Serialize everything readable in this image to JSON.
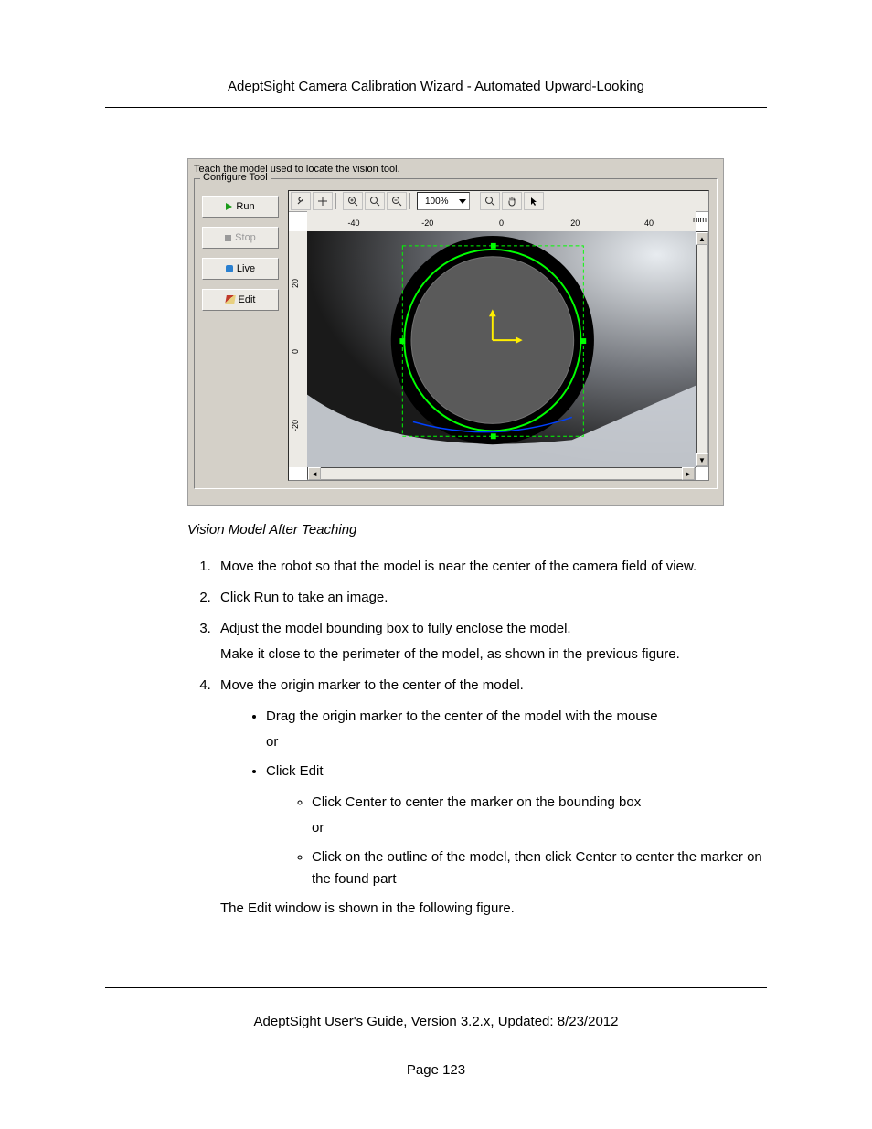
{
  "header": {
    "title": "AdeptSight Camera Calibration Wizard - Automated Upward-Looking"
  },
  "app": {
    "teach_text": "Teach the model used to locate the vision tool.",
    "group_label": "Configure Tool",
    "buttons": {
      "run": "Run",
      "stop": "Stop",
      "live": "Live",
      "edit": "Edit"
    },
    "zoom_value": "100%",
    "ruler_ticks": [
      "-40",
      "-20",
      "0",
      "20",
      "40"
    ],
    "unit": "mm",
    "vruler_ticks": [
      "20",
      "0",
      "-20"
    ]
  },
  "caption": "Vision Model After Teaching",
  "steps": {
    "s1": "Move the robot so that the model is near the center of the camera field of view.",
    "s2": "Click Run to take an image.",
    "s3a": "Adjust the model bounding box to fully enclose the model.",
    "s3b": "Make it close to the perimeter of the model, as shown in the previous figure.",
    "s4": "Move the origin marker to the center of the model.",
    "s4_b1": "Drag the origin marker to the center of the model with the mouse",
    "or1": "or",
    "s4_b2": "Click Edit",
    "s4_b2_s1": "Click Center to center the marker on the bounding box",
    "or2": "or",
    "s4_b2_s2": "Click on the outline of the model, then click Center to center the marker on the found part",
    "s4_tail": "The Edit window is shown in the following figure."
  },
  "footer": {
    "text": "AdeptSight User's Guide,  Version 3.2.x, Updated: 8/23/2012",
    "page": "Page 123"
  }
}
